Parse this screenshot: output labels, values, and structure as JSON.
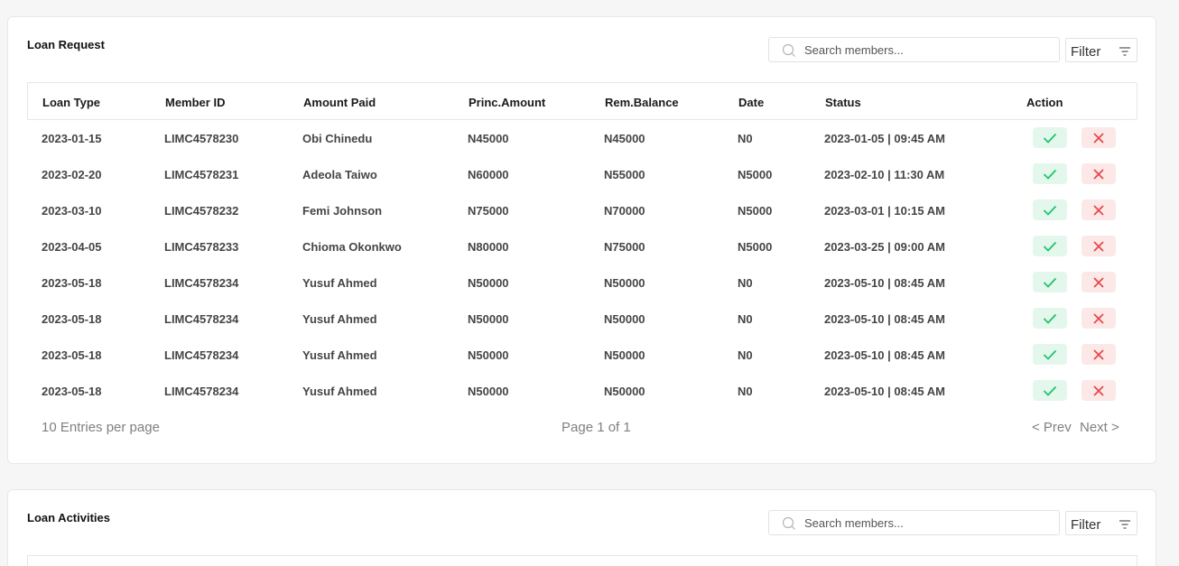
{
  "loan_request": {
    "title": "Loan Request",
    "search_placeholder": "Search members...",
    "filter_label": "Filter",
    "columns": [
      "Loan Type",
      "Member ID",
      "Amount Paid",
      "Princ.Amount",
      "Rem.Balance",
      "Date",
      "Status",
      "Action"
    ],
    "rows": [
      [
        "2023-01-15",
        "LIMC4578230",
        "Obi Chinedu",
        "N45000",
        "N45000",
        "N0",
        "2023-01-05 | 09:45 AM"
      ],
      [
        "2023-02-20",
        "LIMC4578231",
        "Adeola Taiwo",
        "N60000",
        "N55000",
        "N5000",
        "2023-02-10 | 11:30 AM"
      ],
      [
        "2023-03-10",
        "LIMC4578232",
        "Femi Johnson",
        "N75000",
        "N70000",
        "N5000",
        "2023-03-01 | 10:15 AM"
      ],
      [
        "2023-04-05",
        "LIMC4578233",
        "Chioma Okonkwo",
        "N80000",
        "N75000",
        "N5000",
        "2023-03-25 | 09:00 AM"
      ],
      [
        "2023-05-18",
        "LIMC4578234",
        "Yusuf Ahmed",
        "N50000",
        "N50000",
        "N0",
        "2023-05-10 | 08:45 AM"
      ],
      [
        "2023-05-18",
        "LIMC4578234",
        "Yusuf Ahmed",
        "N50000",
        "N50000",
        "N0",
        "2023-05-10 | 08:45 AM"
      ],
      [
        "2023-05-18",
        "LIMC4578234",
        "Yusuf Ahmed",
        "N50000",
        "N50000",
        "N0",
        "2023-05-10 | 08:45 AM"
      ],
      [
        "2023-05-18",
        "LIMC4578234",
        "Yusuf Ahmed",
        "N50000",
        "N50000",
        "N0",
        "2023-05-10 | 08:45 AM"
      ]
    ],
    "footer": {
      "per_page": "10 Entries per page",
      "page_info": "Page 1 of 1",
      "prev": "< Prev",
      "next": "Next >"
    }
  },
  "loan_activities": {
    "title": "Loan Activities",
    "search_placeholder": "Search members...",
    "filter_label": "Filter"
  },
  "icons": {
    "approve": "check-icon",
    "reject": "close-icon",
    "search": "search-icon",
    "filter": "filter-icon"
  },
  "colors": {
    "approve_bg": "#e4f7ec",
    "approve_fg": "#1ec46e",
    "reject_bg": "#fde8e8",
    "reject_fg": "#e8474a"
  }
}
